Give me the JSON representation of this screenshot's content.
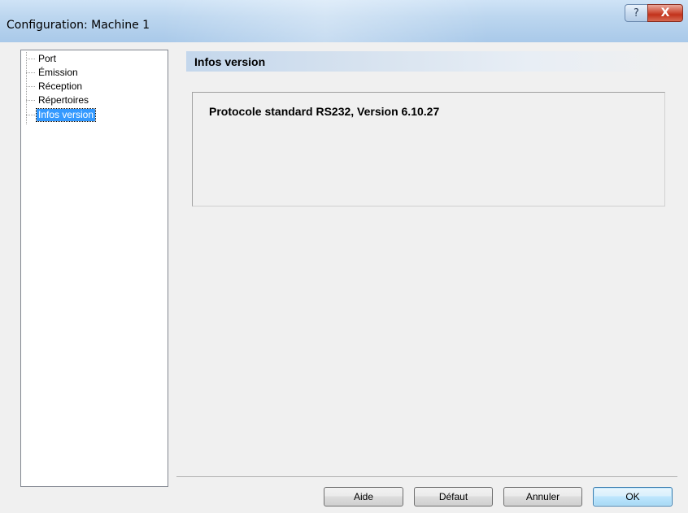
{
  "window": {
    "title": "Configuration: Machine 1",
    "help_glyph": "?",
    "close_glyph": "X"
  },
  "tree": {
    "items": [
      {
        "label": "Port"
      },
      {
        "label": "Émission"
      },
      {
        "label": "Réception"
      },
      {
        "label": "Répertoires"
      },
      {
        "label": "Infos version",
        "selected": true
      }
    ]
  },
  "section": {
    "title": "Infos version",
    "version_text": "Protocole standard RS232, Version 6.10.27"
  },
  "buttons": {
    "help": "Aide",
    "default": "Défaut",
    "cancel": "Annuler",
    "ok": "OK"
  }
}
